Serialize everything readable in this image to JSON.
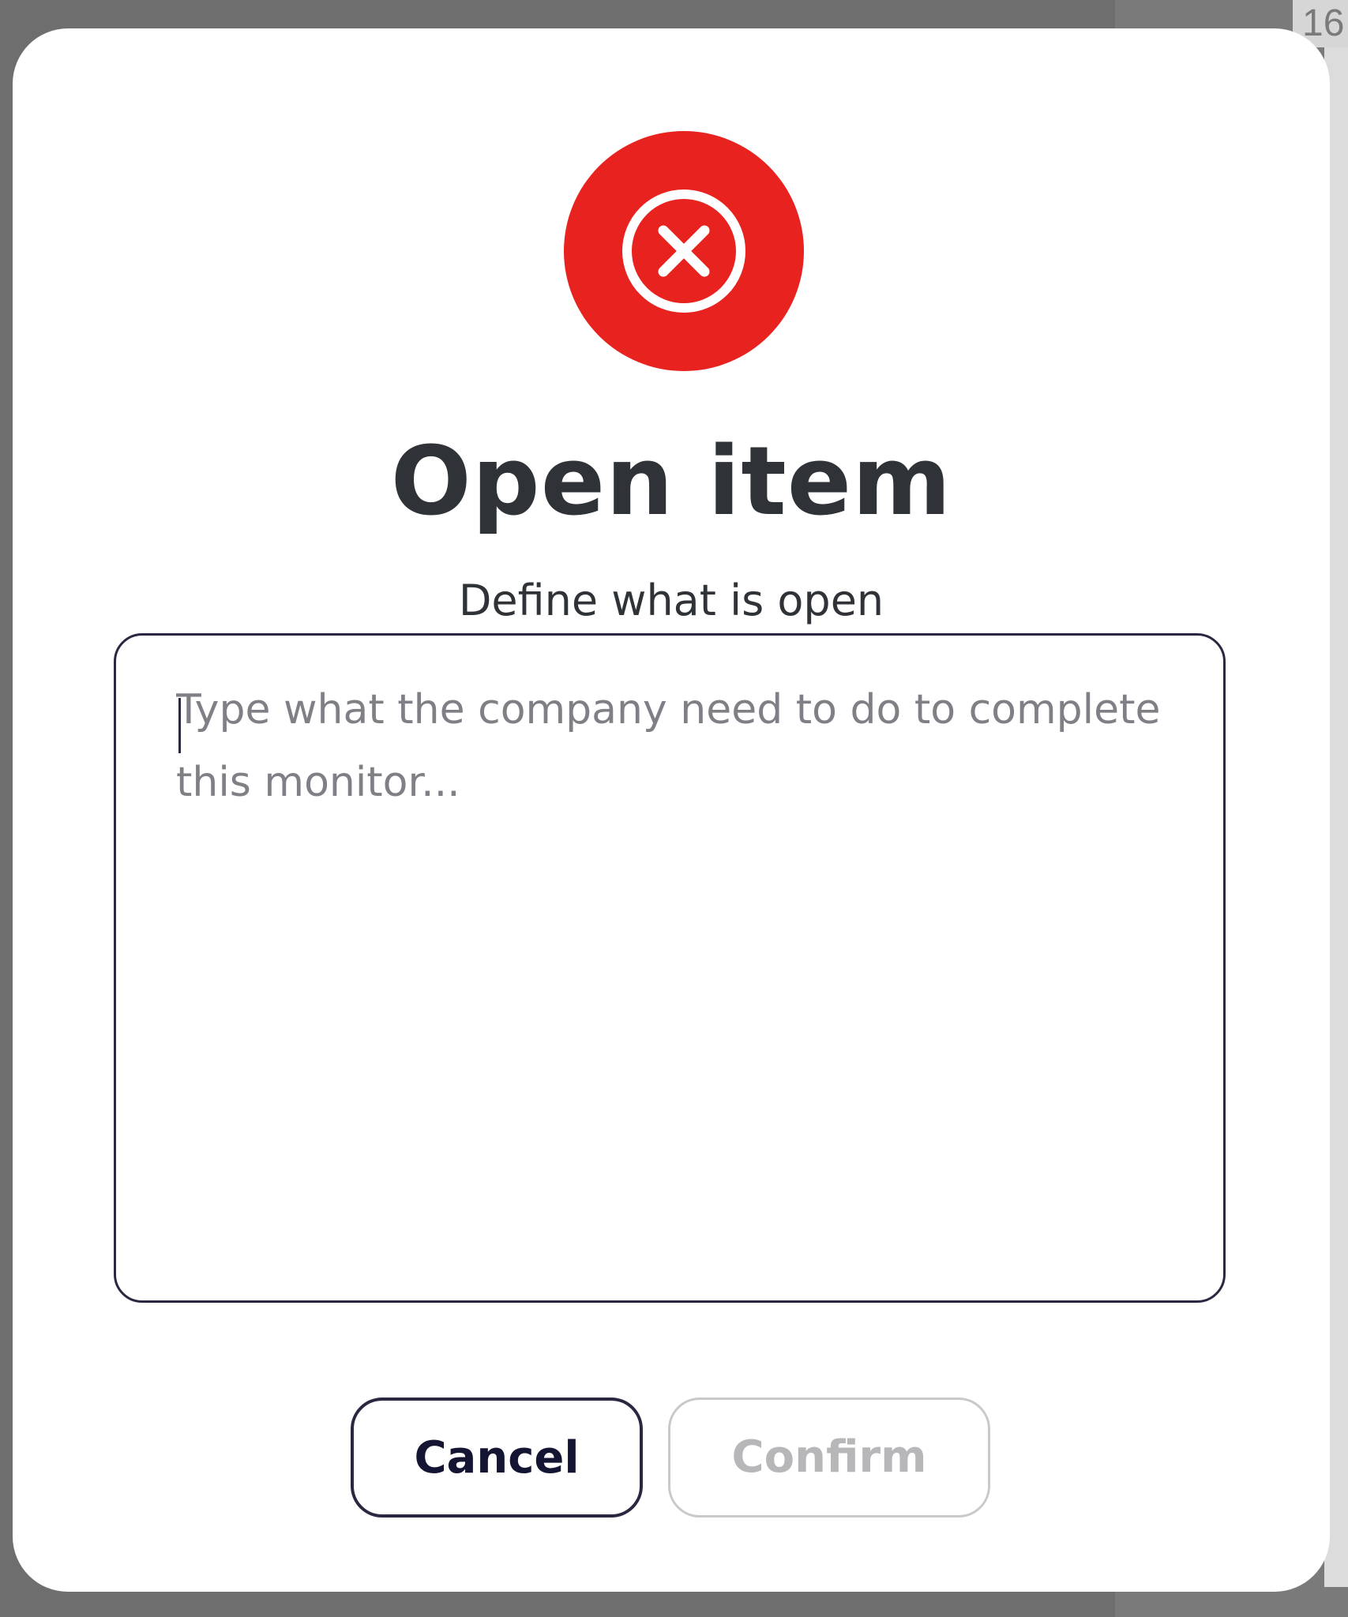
{
  "background": {
    "corner_number": "16"
  },
  "dialog": {
    "icon": "error-x-circle-icon",
    "icon_color": "#e8231f",
    "title": "Open item",
    "subtitle": "Define what is open",
    "textarea": {
      "value": "",
      "placeholder": "Type what the company need to do to complete this monitor..."
    },
    "buttons": {
      "cancel_label": "Cancel",
      "confirm_label": "Confirm",
      "confirm_disabled": true
    }
  }
}
